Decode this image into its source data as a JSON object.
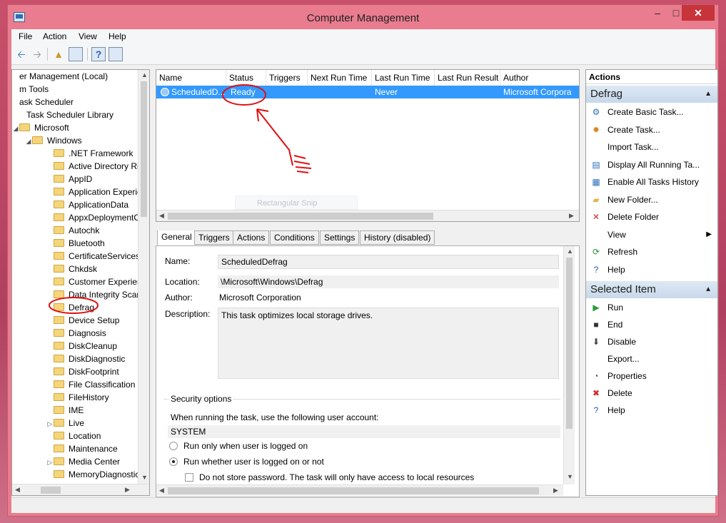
{
  "window": {
    "title": "Computer Management"
  },
  "menu": [
    "File",
    "Action",
    "View",
    "Help"
  ],
  "tree": [
    {
      "label": "er Management (Local)",
      "indent": 0,
      "folder": false,
      "expander": ""
    },
    {
      "label": "m Tools",
      "indent": 0,
      "folder": false,
      "expander": ""
    },
    {
      "label": "ask Scheduler",
      "indent": 0,
      "folder": false,
      "expander": ""
    },
    {
      "label": "Task Scheduler Library",
      "indent": 10,
      "folder": false,
      "expander": ""
    },
    {
      "label": "Microsoft",
      "indent": 0,
      "folder": true,
      "expander": "◢"
    },
    {
      "label": "Windows",
      "indent": 18,
      "folder": true,
      "expander": "◢"
    },
    {
      "label": ".NET Framework",
      "indent": 48,
      "folder": true,
      "expander": ""
    },
    {
      "label": "Active Directory Rig",
      "indent": 48,
      "folder": true,
      "expander": ""
    },
    {
      "label": "AppID",
      "indent": 48,
      "folder": true,
      "expander": ""
    },
    {
      "label": "Application Experie",
      "indent": 48,
      "folder": true,
      "expander": ""
    },
    {
      "label": "ApplicationData",
      "indent": 48,
      "folder": true,
      "expander": ""
    },
    {
      "label": "AppxDeploymentC",
      "indent": 48,
      "folder": true,
      "expander": ""
    },
    {
      "label": "Autochk",
      "indent": 48,
      "folder": true,
      "expander": ""
    },
    {
      "label": "Bluetooth",
      "indent": 48,
      "folder": true,
      "expander": ""
    },
    {
      "label": "CertificateServicesC",
      "indent": 48,
      "folder": true,
      "expander": ""
    },
    {
      "label": "Chkdsk",
      "indent": 48,
      "folder": true,
      "expander": ""
    },
    {
      "label": "Customer Experienc",
      "indent": 48,
      "folder": true,
      "expander": ""
    },
    {
      "label": "Data Integrity Scan",
      "indent": 48,
      "folder": true,
      "expander": ""
    },
    {
      "label": "Defrag",
      "indent": 48,
      "folder": true,
      "expander": ""
    },
    {
      "label": "Device Setup",
      "indent": 48,
      "folder": true,
      "expander": ""
    },
    {
      "label": "Diagnosis",
      "indent": 48,
      "folder": true,
      "expander": ""
    },
    {
      "label": "DiskCleanup",
      "indent": 48,
      "folder": true,
      "expander": ""
    },
    {
      "label": "DiskDiagnostic",
      "indent": 48,
      "folder": true,
      "expander": ""
    },
    {
      "label": "DiskFootprint",
      "indent": 48,
      "folder": true,
      "expander": ""
    },
    {
      "label": "File Classification In",
      "indent": 48,
      "folder": true,
      "expander": ""
    },
    {
      "label": "FileHistory",
      "indent": 48,
      "folder": true,
      "expander": ""
    },
    {
      "label": "IME",
      "indent": 48,
      "folder": true,
      "expander": ""
    },
    {
      "label": "Live",
      "indent": 48,
      "folder": true,
      "expander": "▷"
    },
    {
      "label": "Location",
      "indent": 48,
      "folder": true,
      "expander": ""
    },
    {
      "label": "Maintenance",
      "indent": 48,
      "folder": true,
      "expander": ""
    },
    {
      "label": "Media Center",
      "indent": 48,
      "folder": true,
      "expander": "▷"
    },
    {
      "label": "MemoryDiagnostic",
      "indent": 48,
      "folder": true,
      "expander": ""
    }
  ],
  "tasklist": {
    "columns": [
      "Name",
      "Status",
      "Triggers",
      "Next Run Time",
      "Last Run Time",
      "Last Run Result",
      "Author"
    ],
    "row": {
      "name": "ScheduledD...",
      "status": "Ready",
      "triggers": "",
      "next_run": "",
      "last_run": "Never",
      "last_result": "",
      "author": "Microsoft Corpora"
    },
    "overlay_text": "Rectangular Snip"
  },
  "tabs": [
    "General",
    "Triggers",
    "Actions",
    "Conditions",
    "Settings",
    "History (disabled)"
  ],
  "general": {
    "name_label": "Name:",
    "name_value": "ScheduledDefrag",
    "location_label": "Location:",
    "location_value": "\\Microsoft\\Windows\\Defrag",
    "author_label": "Author:",
    "author_value": "Microsoft Corporation",
    "description_label": "Description:",
    "description_value": "This task optimizes local storage drives.",
    "security_title": "Security options",
    "account_prompt": "When running the task, use the following user account:",
    "account": "SYSTEM",
    "radio_logged_on": "Run only when user is logged on",
    "radio_whether": "Run whether user is logged on or not",
    "checkbox_no_password": "Do not store password.  The task will only have access to local resources"
  },
  "actions": {
    "header": "Actions",
    "section1": "Defrag",
    "section1_items": [
      {
        "label": "Create Basic Task...",
        "icon": "⚙",
        "color": "#2a6fb8"
      },
      {
        "label": "Create Task...",
        "icon": "✹",
        "color": "#d08a1e"
      },
      {
        "label": "Import Task...",
        "icon": "",
        "color": "#000000"
      },
      {
        "label": "Display All Running Ta...",
        "icon": "▤",
        "color": "#2a6fb8"
      },
      {
        "label": "Enable All Tasks History",
        "icon": "▦",
        "color": "#2a6fb8"
      },
      {
        "label": "New Folder...",
        "icon": "▰",
        "color": "#e0b44a"
      },
      {
        "label": "Delete Folder",
        "icon": "✕",
        "color": "#d22b2b"
      },
      {
        "label": "View",
        "icon": "",
        "color": "#000000",
        "submenu": "▶"
      },
      {
        "label": "Refresh",
        "icon": "⟳",
        "color": "#2a8c3a"
      },
      {
        "label": "Help",
        "icon": "?",
        "color": "#2a5ab8"
      }
    ],
    "section2": "Selected Item",
    "section2_items": [
      {
        "label": "Run",
        "icon": "▶",
        "color": "#2a9a3a"
      },
      {
        "label": "End",
        "icon": "■",
        "color": "#333333"
      },
      {
        "label": "Disable",
        "icon": "⬇",
        "color": "#444444"
      },
      {
        "label": "Export...",
        "icon": "",
        "color": "#000000"
      },
      {
        "label": "Properties",
        "icon": "◔",
        "color": "#555555"
      },
      {
        "label": "Delete",
        "icon": "✖",
        "color": "#d22b2b"
      },
      {
        "label": "Help",
        "icon": "?",
        "color": "#2a5ab8"
      }
    ]
  },
  "colors": {
    "selection": "#3399ff",
    "annotation": "#e01010",
    "window_frame": "#e97c8e"
  }
}
